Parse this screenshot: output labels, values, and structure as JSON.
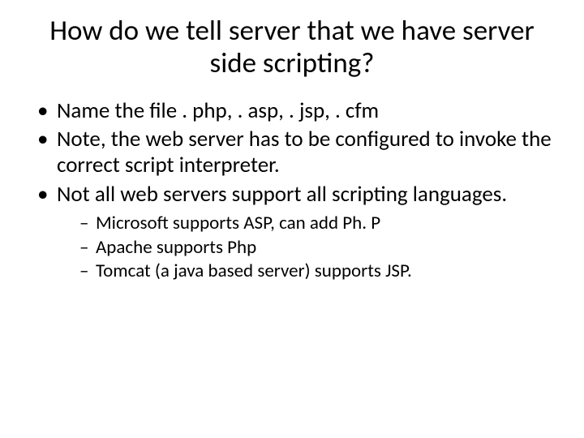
{
  "title": "How do we tell server that we have server side scripting?",
  "bullets": [
    {
      "text": "Name the file . php, . asp, . jsp, . cfm"
    },
    {
      "text": "Note, the web server has to be configured to invoke the correct script interpreter."
    },
    {
      "text": "Not all web servers support all scripting languages.",
      "sub": [
        "Microsoft supports ASP, can add Ph. P",
        "Apache supports Php",
        "Tomcat (a java based server) supports JSP."
      ]
    }
  ]
}
